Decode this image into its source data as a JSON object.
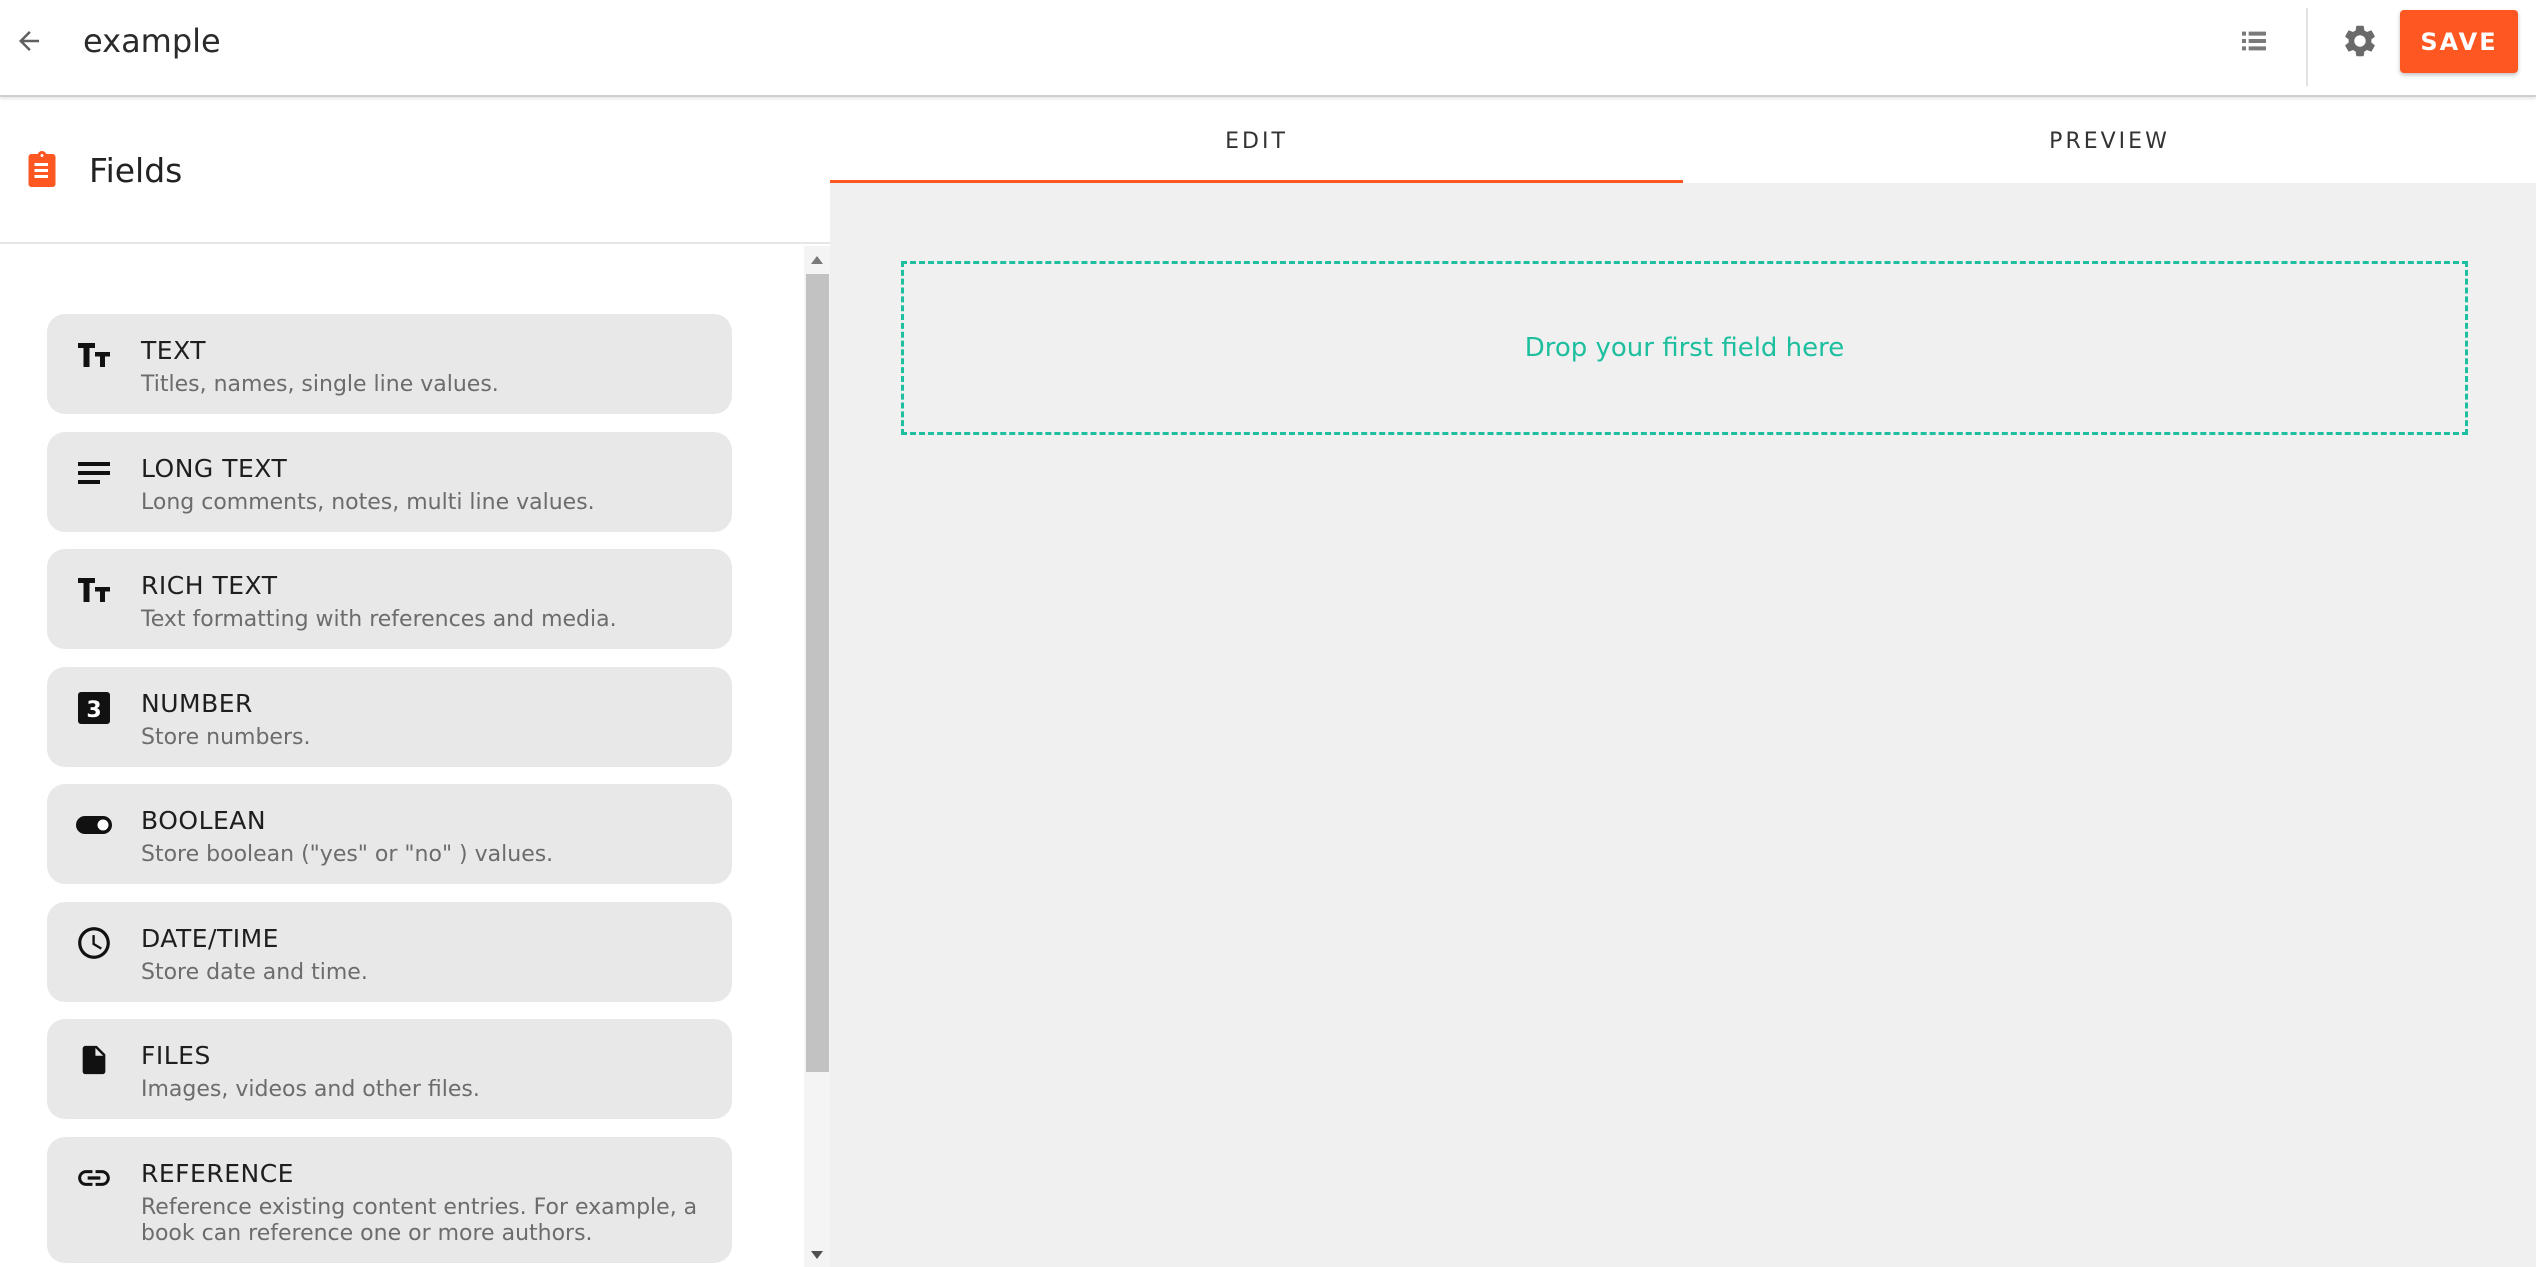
{
  "header": {
    "title": "example",
    "save_label": "SAVE",
    "icons": {
      "back": "arrow-left-icon",
      "list": "list-icon",
      "settings": "gear-icon"
    }
  },
  "sidebar": {
    "title": "Fields",
    "title_icon": "clipboard-icon",
    "items": [
      {
        "name": "TEXT",
        "description": "Titles, names, single line values.",
        "icon": "text-size-icon"
      },
      {
        "name": "LONG TEXT",
        "description": "Long comments, notes, multi line values.",
        "icon": "lines-icon"
      },
      {
        "name": "RICH TEXT",
        "description": "Text formatting with references and media.",
        "icon": "text-size-icon"
      },
      {
        "name": "NUMBER",
        "description": "Store numbers.",
        "icon": "number-3-box-icon"
      },
      {
        "name": "BOOLEAN",
        "description": "Store boolean (\"yes\" or \"no\" ) values.",
        "icon": "toggle-icon"
      },
      {
        "name": "DATE/TIME",
        "description": "Store date and time.",
        "icon": "clock-icon"
      },
      {
        "name": "FILES",
        "description": "Images, videos and other files.",
        "icon": "file-icon"
      },
      {
        "name": "REFERENCE",
        "description": "Reference existing content entries. For example, a book can reference one or more authors.",
        "icon": "link-icon"
      }
    ]
  },
  "tabs": [
    {
      "label": "EDIT",
      "active": true
    },
    {
      "label": "PREVIEW",
      "active": false
    }
  ],
  "editor": {
    "dropzone_text": "Drop your first field here"
  },
  "colors": {
    "accent": "#ff5722",
    "dropzone": "#1dbf9f",
    "card_bg": "#e8e8e8",
    "editor_bg": "#f0f0f0"
  }
}
